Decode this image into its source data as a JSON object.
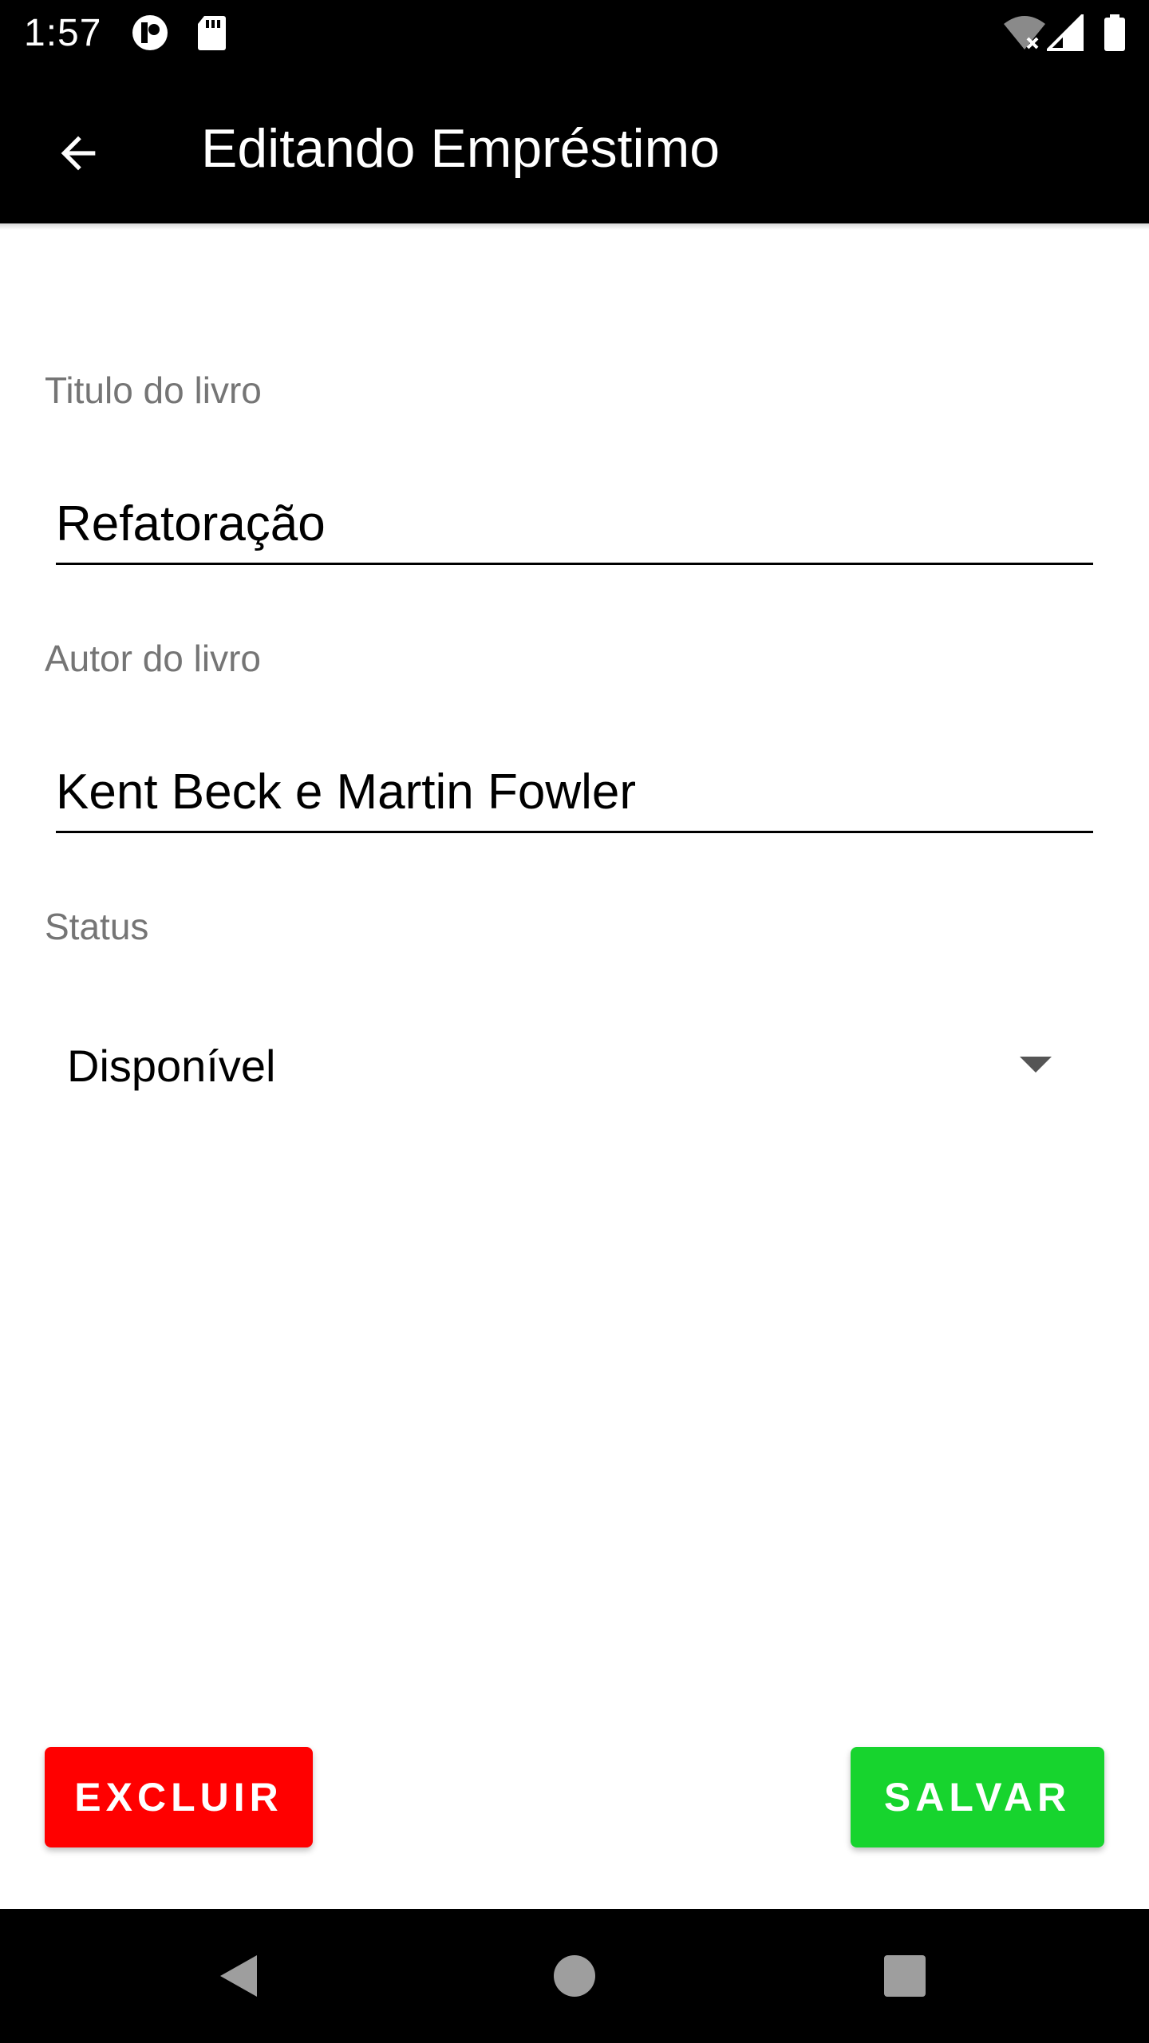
{
  "status_bar": {
    "time": "1:57",
    "icons": [
      "notification-app-icon",
      "sd-card-icon",
      "wifi-off-icon",
      "signal-icon",
      "battery-icon"
    ]
  },
  "app_bar": {
    "title": "Editando Empréstimo",
    "back_icon": "arrow-back-icon"
  },
  "form": {
    "title_field": {
      "label": "Titulo do livro",
      "value": "Refatoração"
    },
    "author_field": {
      "label": "Autor do livro",
      "value": "Kent Beck e Martin Fowler"
    },
    "status_field": {
      "label": "Status",
      "value": "Disponível",
      "icon": "dropdown-arrow-icon"
    }
  },
  "actions": {
    "delete_label": "EXCLUIR",
    "save_label": "SALVAR"
  },
  "nav_bar": {
    "icons": [
      "nav-back-icon",
      "nav-home-icon",
      "nav-recents-icon"
    ]
  },
  "colors": {
    "bar_background": "#000000",
    "delete_button": "#ff0000",
    "save_button": "#17d42e",
    "label_text": "#757575"
  }
}
